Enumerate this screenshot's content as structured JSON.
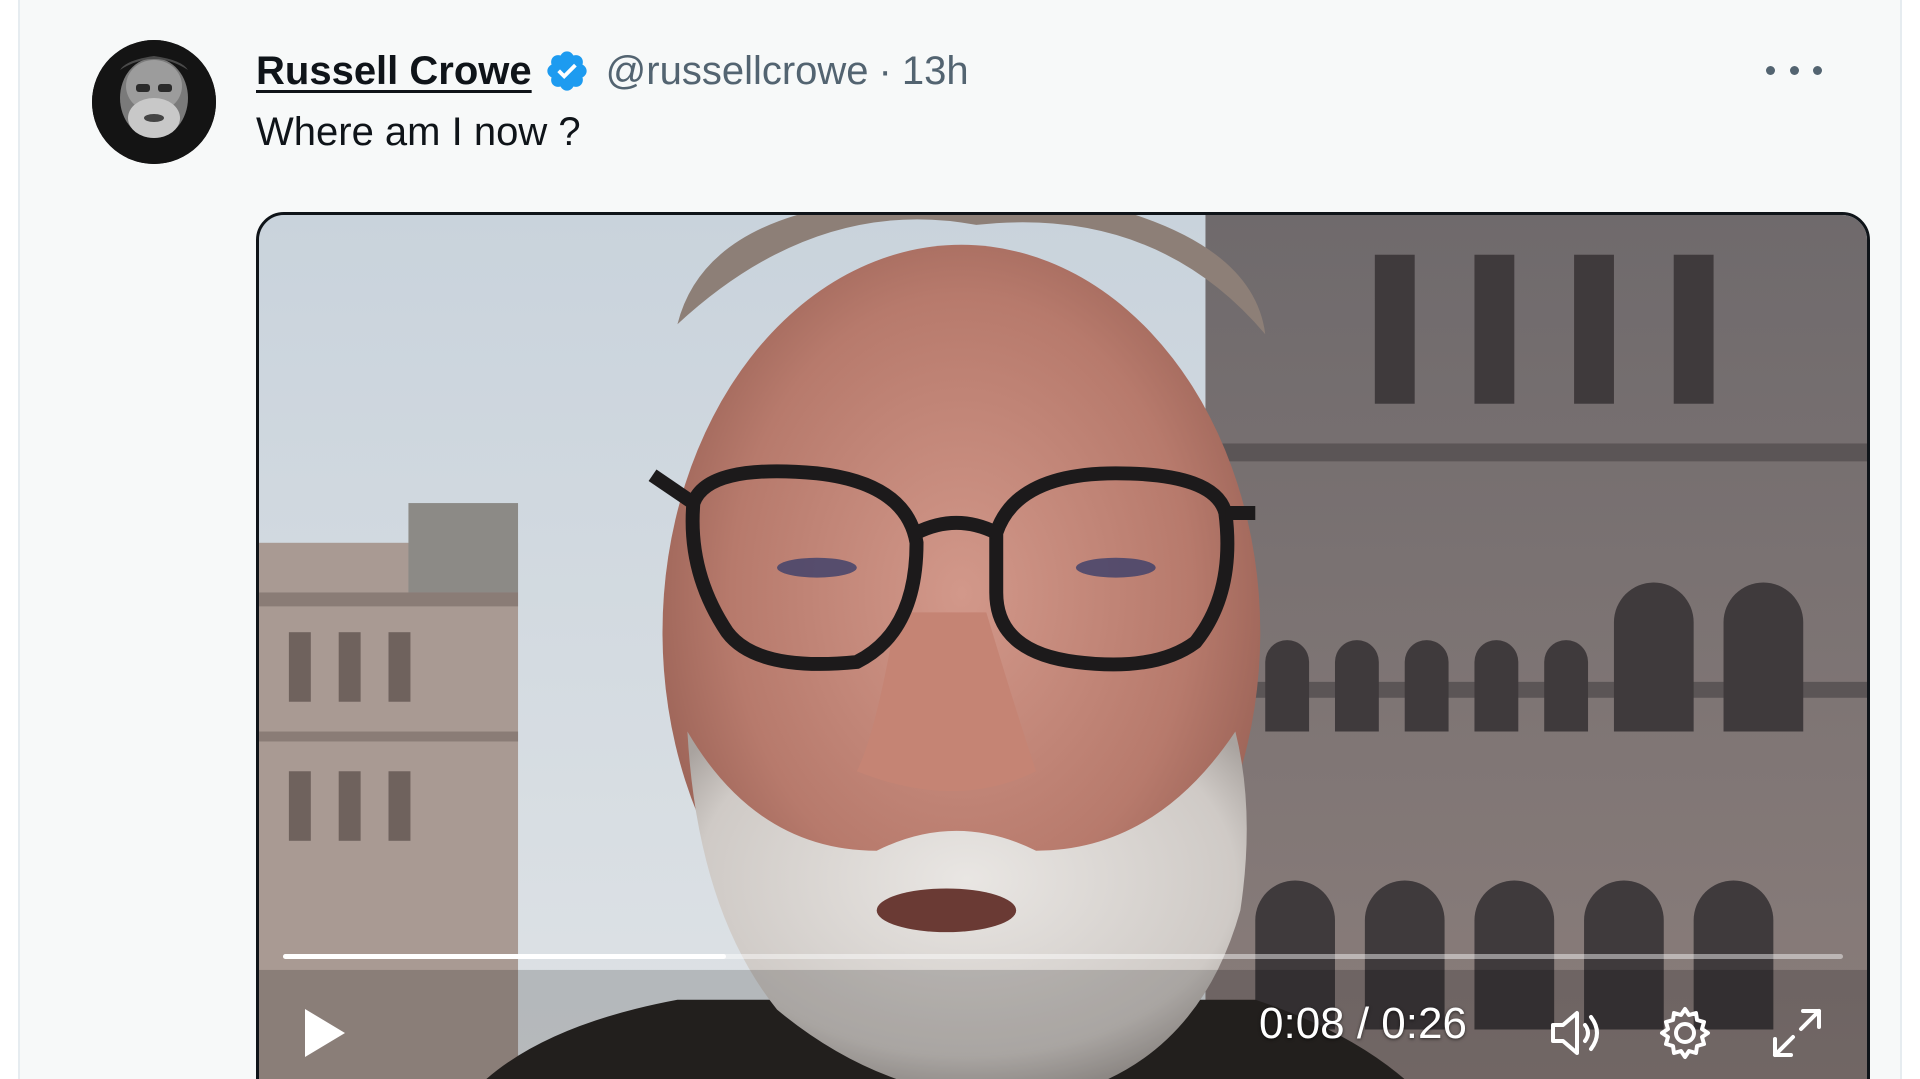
{
  "tweet": {
    "author": {
      "display_name": "Russell Crowe",
      "verified": true,
      "handle": "@russellcrowe",
      "separator": "·",
      "time": "13h"
    },
    "text": "Where am I now ?",
    "more_icon": "more-horizontal-icon"
  },
  "video": {
    "current_time": "0:08",
    "duration": "0:26",
    "time_display": "0:08 / 0:26",
    "progress_fraction": 0.2837,
    "controls": {
      "play_icon": "play-icon",
      "volume_icon": "volume-icon",
      "settings_icon": "gear-icon",
      "fullscreen_icon": "expand-icon"
    }
  },
  "colors": {
    "verified_badge": "#1d9bf0",
    "text_primary": "#0f1419",
    "text_secondary": "#536471",
    "card_background": "#f7f9f9"
  }
}
